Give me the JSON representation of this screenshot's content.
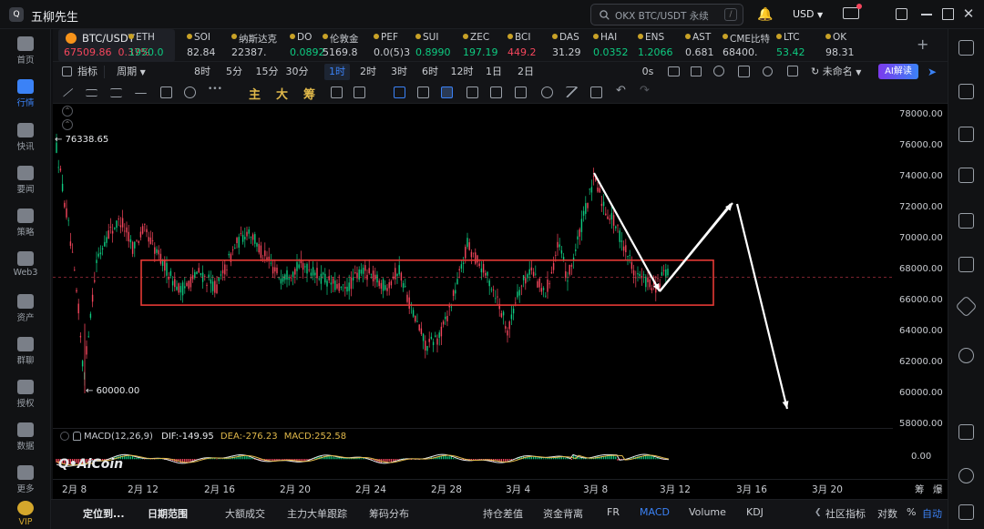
{
  "app": {
    "title": "五柳先生",
    "logo_text": "Q"
  },
  "search": {
    "placeholder": "OKX BTC/USDT 永续",
    "shortcut": "/"
  },
  "currency": "USD",
  "left_nav": [
    {
      "label": "首页",
      "icon": "home-icon"
    },
    {
      "label": "行情",
      "icon": "market-icon",
      "active": true
    },
    {
      "label": "快讯",
      "icon": "news-flash-icon"
    },
    {
      "label": "要闻",
      "icon": "headline-icon"
    },
    {
      "label": "策略",
      "icon": "strategy-icon"
    },
    {
      "label": "Web3",
      "icon": "web3-icon"
    },
    {
      "label": "资产",
      "icon": "wallet-icon"
    },
    {
      "label": "群聊",
      "icon": "chat-icon"
    },
    {
      "label": "授权",
      "icon": "auth-icon"
    },
    {
      "label": "数据",
      "icon": "data-icon"
    },
    {
      "label": "更多",
      "icon": "more-icon"
    },
    {
      "label": "VIP",
      "icon": "vip-icon"
    }
  ],
  "tickers": [
    {
      "name": "BTC/USDT",
      "price": "67509.86",
      "change": "0.37%",
      "color": "#f6465d"
    },
    {
      "name": "ETH",
      "price": "1950.0",
      "color": "#0ecb81"
    },
    {
      "name": "SOI",
      "price": "82.84",
      "color": "#c9ccd1"
    },
    {
      "name": "纳斯达克",
      "price": "22387.",
      "color": "#c9ccd1"
    },
    {
      "name": "DO",
      "price": "0.0892",
      "color": "#0ecb81"
    },
    {
      "name": "伦敦金",
      "price": "5169.8",
      "color": "#c9ccd1"
    },
    {
      "name": "PEF",
      "price": "0.0(5)3",
      "color": "#c9ccd1"
    },
    {
      "name": "SUI",
      "price": "0.8990",
      "color": "#0ecb81"
    },
    {
      "name": "ZEC",
      "price": "197.19",
      "color": "#0ecb81"
    },
    {
      "name": "BCI",
      "price": "449.2",
      "color": "#f6465d"
    },
    {
      "name": "DAS",
      "price": "31.29",
      "color": "#c9ccd1"
    },
    {
      "name": "HAI",
      "price": "0.0352",
      "color": "#0ecb81"
    },
    {
      "name": "ENS",
      "price": "1.2066",
      "color": "#0ecb81"
    },
    {
      "name": "AST",
      "price": "0.681",
      "color": "#c9ccd1"
    },
    {
      "name": "CME比特",
      "price": "68400.",
      "color": "#c9ccd1"
    },
    {
      "name": "LTC",
      "price": "53.42",
      "color": "#0ecb81"
    },
    {
      "name": "OK",
      "price": "98.31",
      "color": "#c9ccd1"
    }
  ],
  "toolbar": {
    "indicator_label": "指标",
    "period_label": "周期",
    "timeframes": [
      "8时",
      "5分",
      "15分",
      "30分",
      "1时",
      "2时",
      "3时",
      "6时",
      "12时",
      "1日",
      "2日"
    ],
    "active_timeframe": "1时",
    "zero_s": "0s",
    "layout_name": "未命名",
    "ai_label": "AI解读"
  },
  "drawing_tools": {
    "main": "主",
    "big": "大",
    "chip": "筹"
  },
  "chart": {
    "price_ticks": [
      "78000.00",
      "76000.00",
      "74000.00",
      "72000.00",
      "70000.00",
      "68000.00",
      "66000.00",
      "64000.00",
      "62000.00",
      "60000.00",
      "58000.00"
    ],
    "high_label": "76338.65",
    "low_label": "60000.00",
    "current_price_line": 67509.86,
    "watermark": "AiCoin",
    "dates": [
      "2月 8",
      "2月 12",
      "2月 16",
      "2月 20",
      "2月 24",
      "2月 28",
      "3月 4",
      "3月 8",
      "3月 12",
      "3月 16",
      "3月 20"
    ],
    "range_box": {
      "price_high": 68600,
      "price_low": 65700
    },
    "up_color": "#0ecb81",
    "down_color": "#f6465d"
  },
  "macd": {
    "title": "MACD(12,26,9)",
    "dif": "DIF:-149.95",
    "dea": "DEA:-276.23",
    "macd_value": "MACD:252.58",
    "axis_tick": "0.00",
    "dif_color": "#e6e8eb",
    "dea_color": "#e0b84a",
    "macd_color": "#e0b84a"
  },
  "axis_controls": {
    "percent": "%",
    "log": "对数",
    "auto": "自动",
    "fill_btn": "筹",
    "burst_btn": "爆"
  },
  "bottom_tabs": [
    "定位到...",
    "日期范围",
    "大额成交",
    "主力大单跟踪",
    "筹码分布",
    "持仓差值",
    "资金背离",
    "FR",
    "MACD",
    "Volume",
    "KDJ",
    "社区指标"
  ],
  "active_bottom_tab": "MACD"
}
